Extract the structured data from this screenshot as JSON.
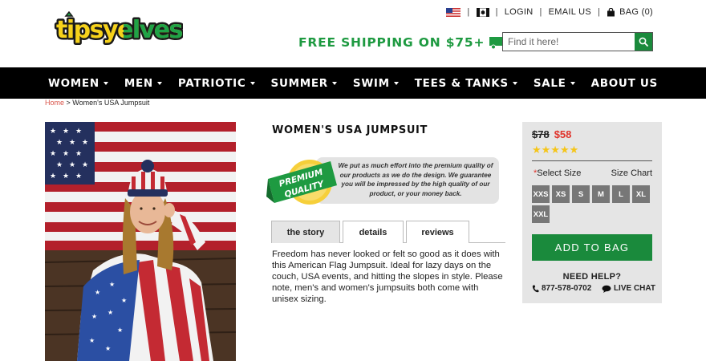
{
  "header": {
    "logo_text": "tipsyelves",
    "util_links": {
      "login": "LOGIN",
      "email": "EMAIL US",
      "bag": "BAG (0)"
    },
    "shipping_banner": "FREE SHIPPING ON $75+",
    "search": {
      "placeholder": "Find it here!"
    },
    "icons": [
      "us-flag-icon",
      "canada-flag-icon",
      "bag-icon",
      "truck-icon",
      "search-icon"
    ]
  },
  "nav": {
    "items": [
      {
        "label": "WOMEN",
        "dropdown": true
      },
      {
        "label": "MEN",
        "dropdown": true
      },
      {
        "label": "PATRIOTIC",
        "dropdown": true
      },
      {
        "label": "SUMMER",
        "dropdown": true
      },
      {
        "label": "SWIM",
        "dropdown": true
      },
      {
        "label": "TEES & TANKS",
        "dropdown": true
      },
      {
        "label": "SALE",
        "dropdown": true
      },
      {
        "label": "ABOUT US",
        "dropdown": false
      }
    ]
  },
  "breadcrumb": {
    "home": "Home",
    "separator": " > ",
    "current": "Women's USA Jumpsuit"
  },
  "product": {
    "title": "WOMEN'S USA JUMPSUIT",
    "quality_badge": {
      "line1": "PREMIUM",
      "line2": "QUALITY"
    },
    "quality_text": "We put as much effort into the premium quality of our products as we do the design. We guarantee you will be impressed by the high quality of our product, or your money back.",
    "tabs": [
      {
        "label": "the story",
        "active": true
      },
      {
        "label": "details",
        "active": false
      },
      {
        "label": "reviews",
        "active": false
      }
    ],
    "description": "Freedom has never looked or felt so good as it does with this American Flag Jumpsuit. Ideal for lazy days on the couch, USA events, and hitting the slopes in style. Please note, men's and women's jumpsuits both come with unisex sizing."
  },
  "buybox": {
    "old_price": "$78",
    "new_price": "$58",
    "rating": 5,
    "stars": "★★★★★",
    "required_mark": "*",
    "select_size": "Select Size",
    "size_chart": "Size Chart",
    "sizes": [
      "XXS",
      "XS",
      "S",
      "M",
      "L",
      "XL",
      "XXL"
    ],
    "add_to_bag": "ADD TO BAG",
    "need_help": "NEED HELP?",
    "phone": "877-578-0702",
    "live_chat": "LIVE CHAT"
  },
  "colors": {
    "brand_green": "#1a8a3c",
    "sale_red": "#e0332b",
    "nav_bg": "#000000",
    "star": "#f5c518"
  }
}
